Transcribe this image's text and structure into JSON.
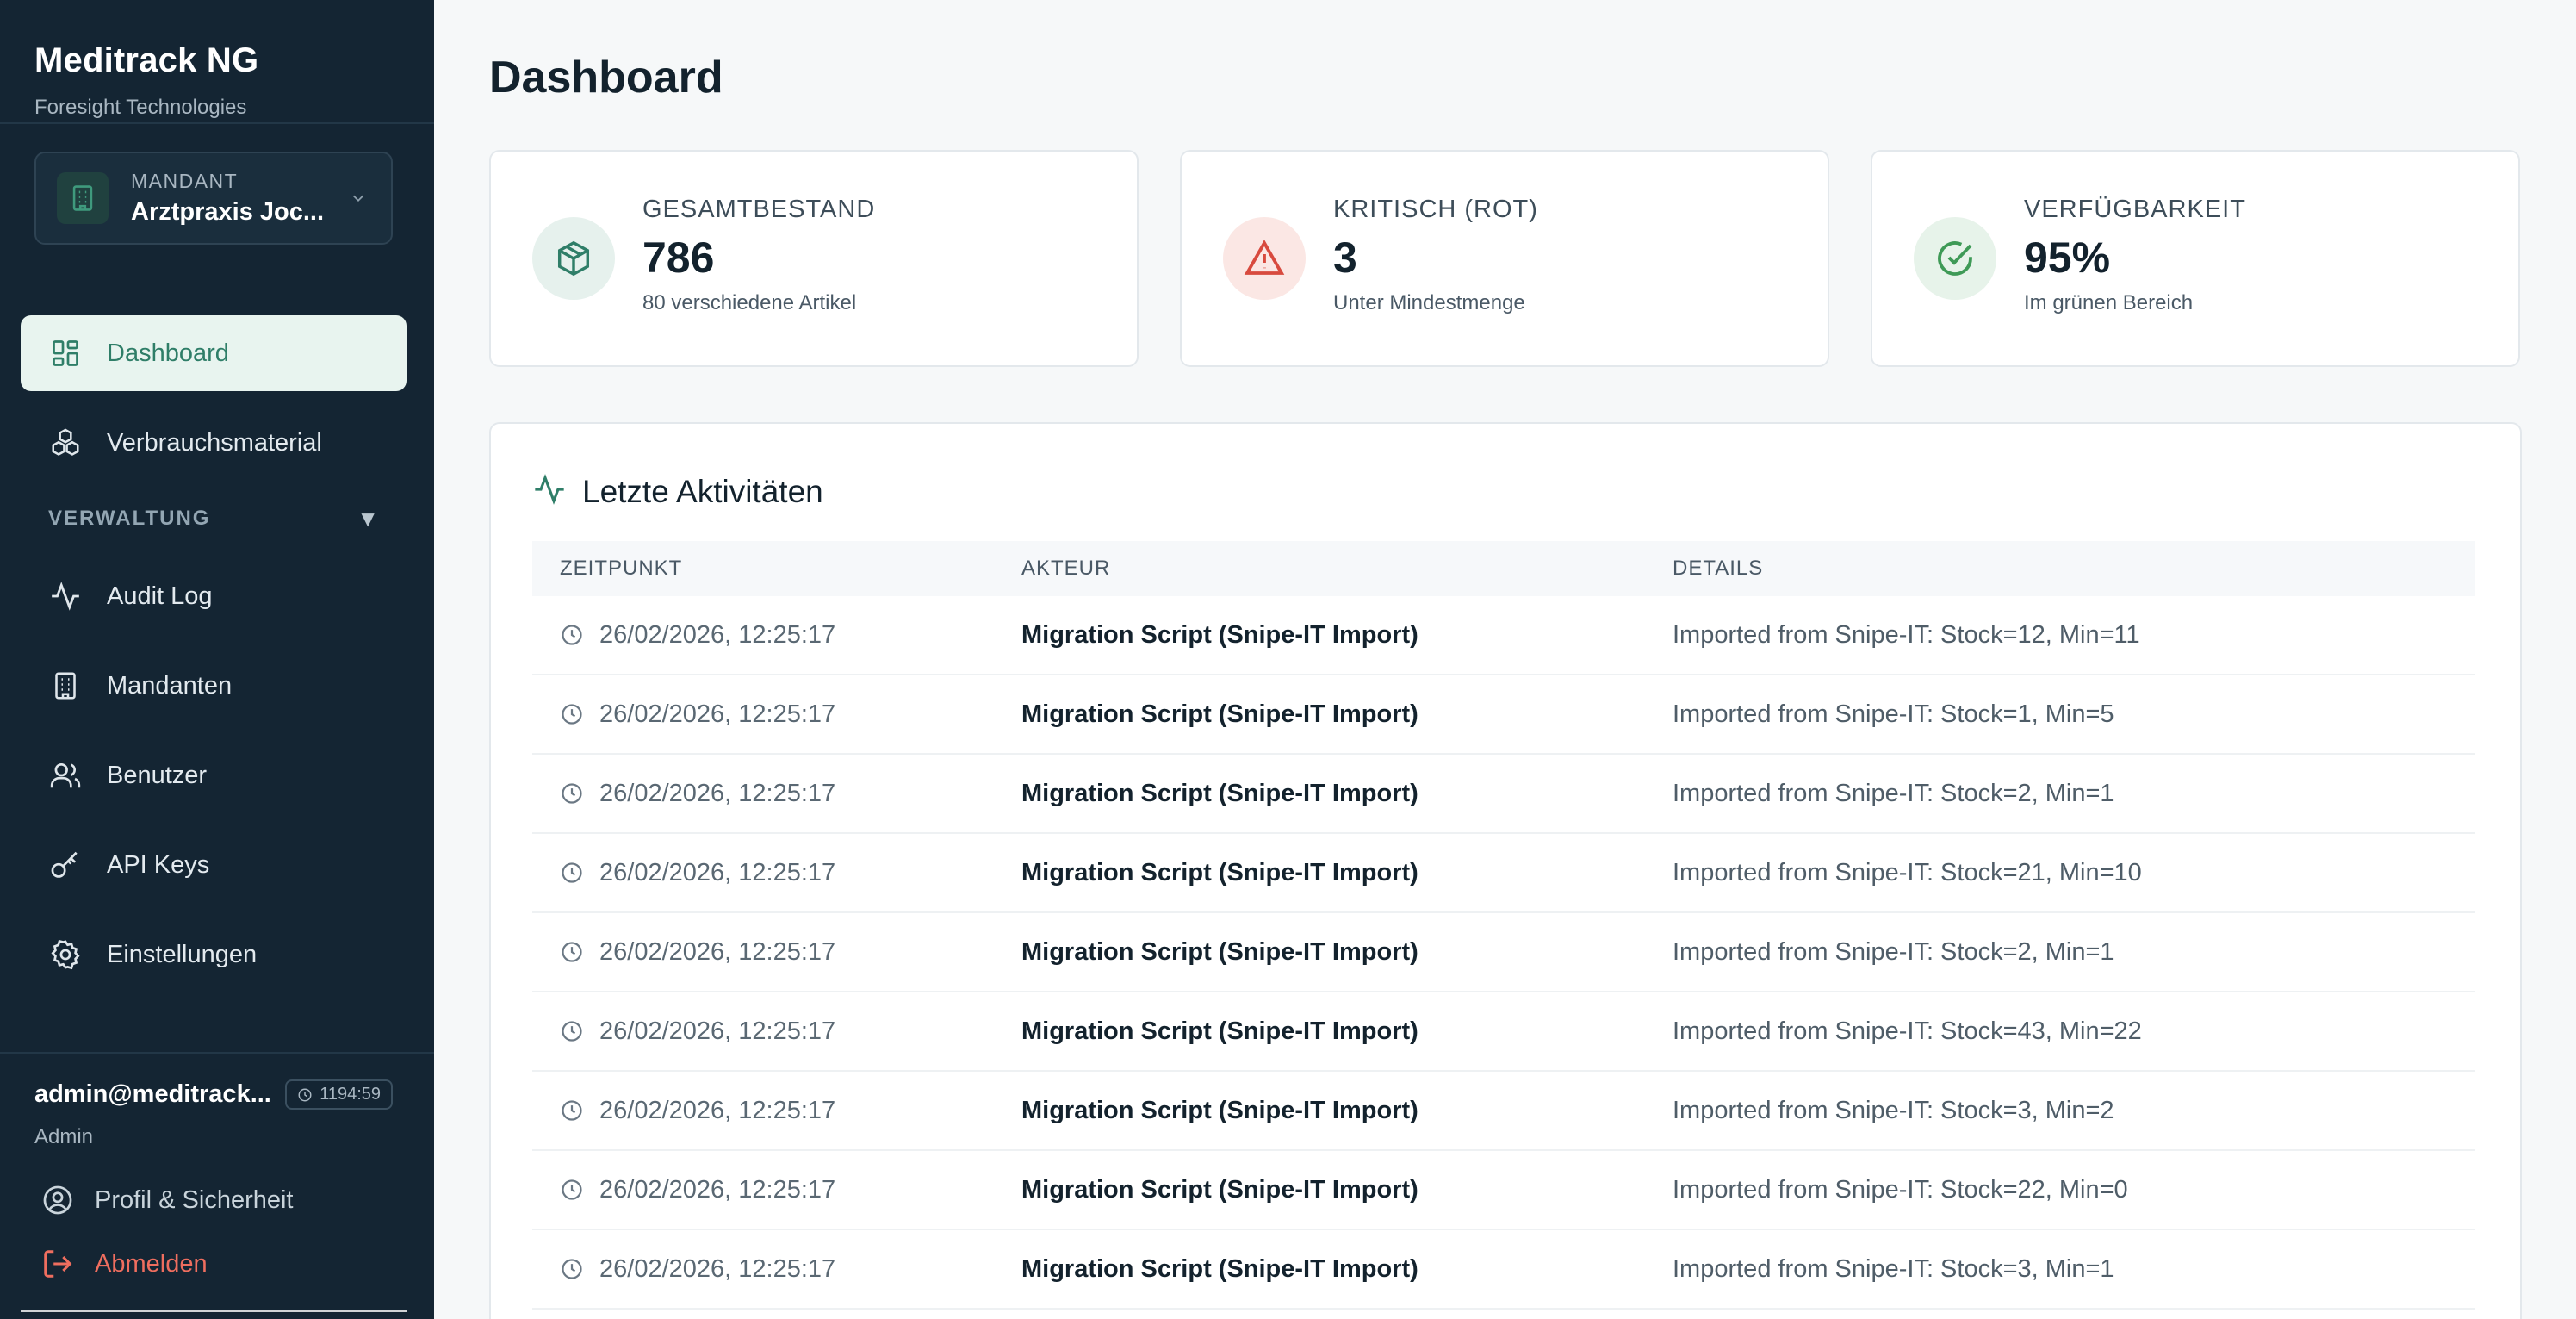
{
  "app": {
    "title": "Meditrack NG",
    "subtitle": "Foresight Technologies"
  },
  "tenant": {
    "label": "MANDANT",
    "name": "Arztpraxis Joc..."
  },
  "nav": {
    "dashboard": "Dashboard",
    "consumables": "Verbrauchsmaterial",
    "section_label": "VERWALTUNG",
    "section_toggle": "▼",
    "audit": "Audit Log",
    "tenants": "Mandanten",
    "users": "Benutzer",
    "api_keys": "API Keys",
    "settings": "Einstellungen"
  },
  "user": {
    "email": "admin@meditrack...",
    "session_timer": "1194:59",
    "role": "Admin",
    "profile_link": "Profil & Sicherheit",
    "logout_link": "Abmelden"
  },
  "page": {
    "title": "Dashboard"
  },
  "stats": [
    {
      "label": "GESAMTBESTAND",
      "value": "786",
      "sub": "80 verschiedene Artikel",
      "icon": "package-icon",
      "color": "#2f7e68"
    },
    {
      "label": "KRITISCH (ROT)",
      "value": "3",
      "sub": "Unter Mindestmenge",
      "icon": "alert-triangle-icon",
      "color": "#d84a3e"
    },
    {
      "label": "VERFÜGBARKEIT",
      "value": "95%",
      "sub": "Im grünen Bereich",
      "icon": "check-circle-icon",
      "color": "#3f9a57"
    }
  ],
  "activity": {
    "title": "Letzte Aktivitäten",
    "columns": [
      "ZEITPUNKT",
      "AKTEUR",
      "DETAILS"
    ],
    "rows": [
      {
        "time": "26/02/2026, 12:25:17",
        "actor": "Migration Script (Snipe-IT Import)",
        "details": "Imported from Snipe-IT: Stock=12, Min=11"
      },
      {
        "time": "26/02/2026, 12:25:17",
        "actor": "Migration Script (Snipe-IT Import)",
        "details": "Imported from Snipe-IT: Stock=1, Min=5"
      },
      {
        "time": "26/02/2026, 12:25:17",
        "actor": "Migration Script (Snipe-IT Import)",
        "details": "Imported from Snipe-IT: Stock=2, Min=1"
      },
      {
        "time": "26/02/2026, 12:25:17",
        "actor": "Migration Script (Snipe-IT Import)",
        "details": "Imported from Snipe-IT: Stock=21, Min=10"
      },
      {
        "time": "26/02/2026, 12:25:17",
        "actor": "Migration Script (Snipe-IT Import)",
        "details": "Imported from Snipe-IT: Stock=2, Min=1"
      },
      {
        "time": "26/02/2026, 12:25:17",
        "actor": "Migration Script (Snipe-IT Import)",
        "details": "Imported from Snipe-IT: Stock=43, Min=22"
      },
      {
        "time": "26/02/2026, 12:25:17",
        "actor": "Migration Script (Snipe-IT Import)",
        "details": "Imported from Snipe-IT: Stock=3, Min=2"
      },
      {
        "time": "26/02/2026, 12:25:17",
        "actor": "Migration Script (Snipe-IT Import)",
        "details": "Imported from Snipe-IT: Stock=22, Min=0"
      },
      {
        "time": "26/02/2026, 12:25:17",
        "actor": "Migration Script (Snipe-IT Import)",
        "details": "Imported from Snipe-IT: Stock=3, Min=1"
      }
    ]
  }
}
